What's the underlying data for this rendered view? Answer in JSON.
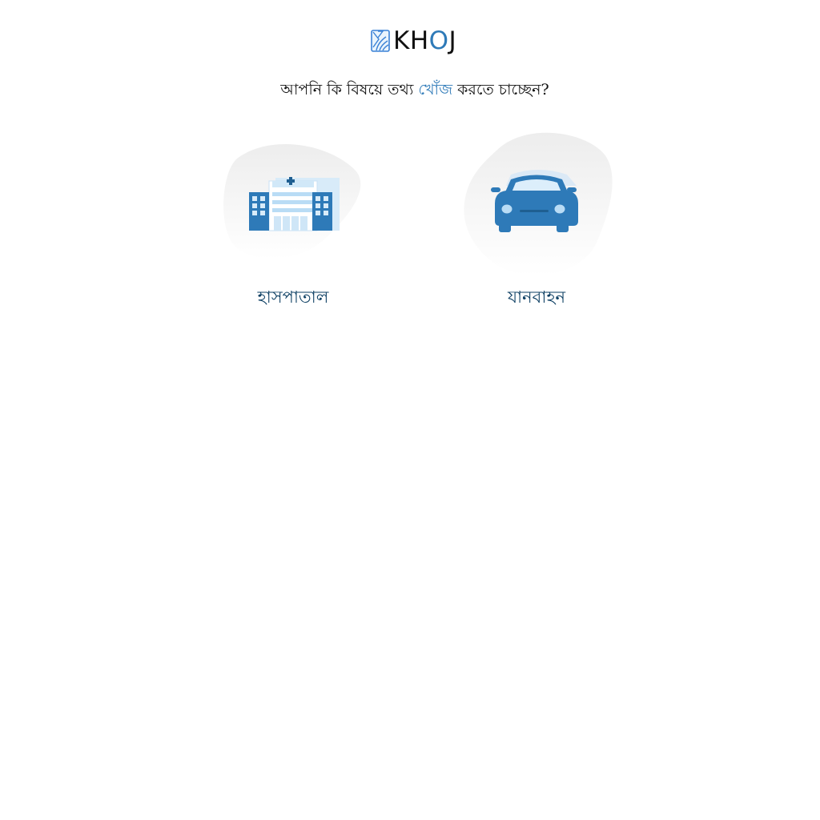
{
  "brand": {
    "logo_prefix": "KH",
    "logo_o": "O",
    "logo_suffix": "J",
    "accent_color": "#2e7ab8"
  },
  "question": {
    "before": "আপনি কি বিষয়ে তথ্য ",
    "highlight": "খোঁজ",
    "after": " করতে চাচ্ছেন?"
  },
  "categories": [
    {
      "label": "হাসপাতাল",
      "icon": "hospital-icon"
    },
    {
      "label": "যানবাহন",
      "icon": "car-icon"
    }
  ],
  "colors": {
    "label_color": "#0d3f63",
    "icon_blue": "#2e7ab8",
    "icon_light_blue": "#b9dcf5",
    "blob_gray": "#f2f2f2"
  }
}
